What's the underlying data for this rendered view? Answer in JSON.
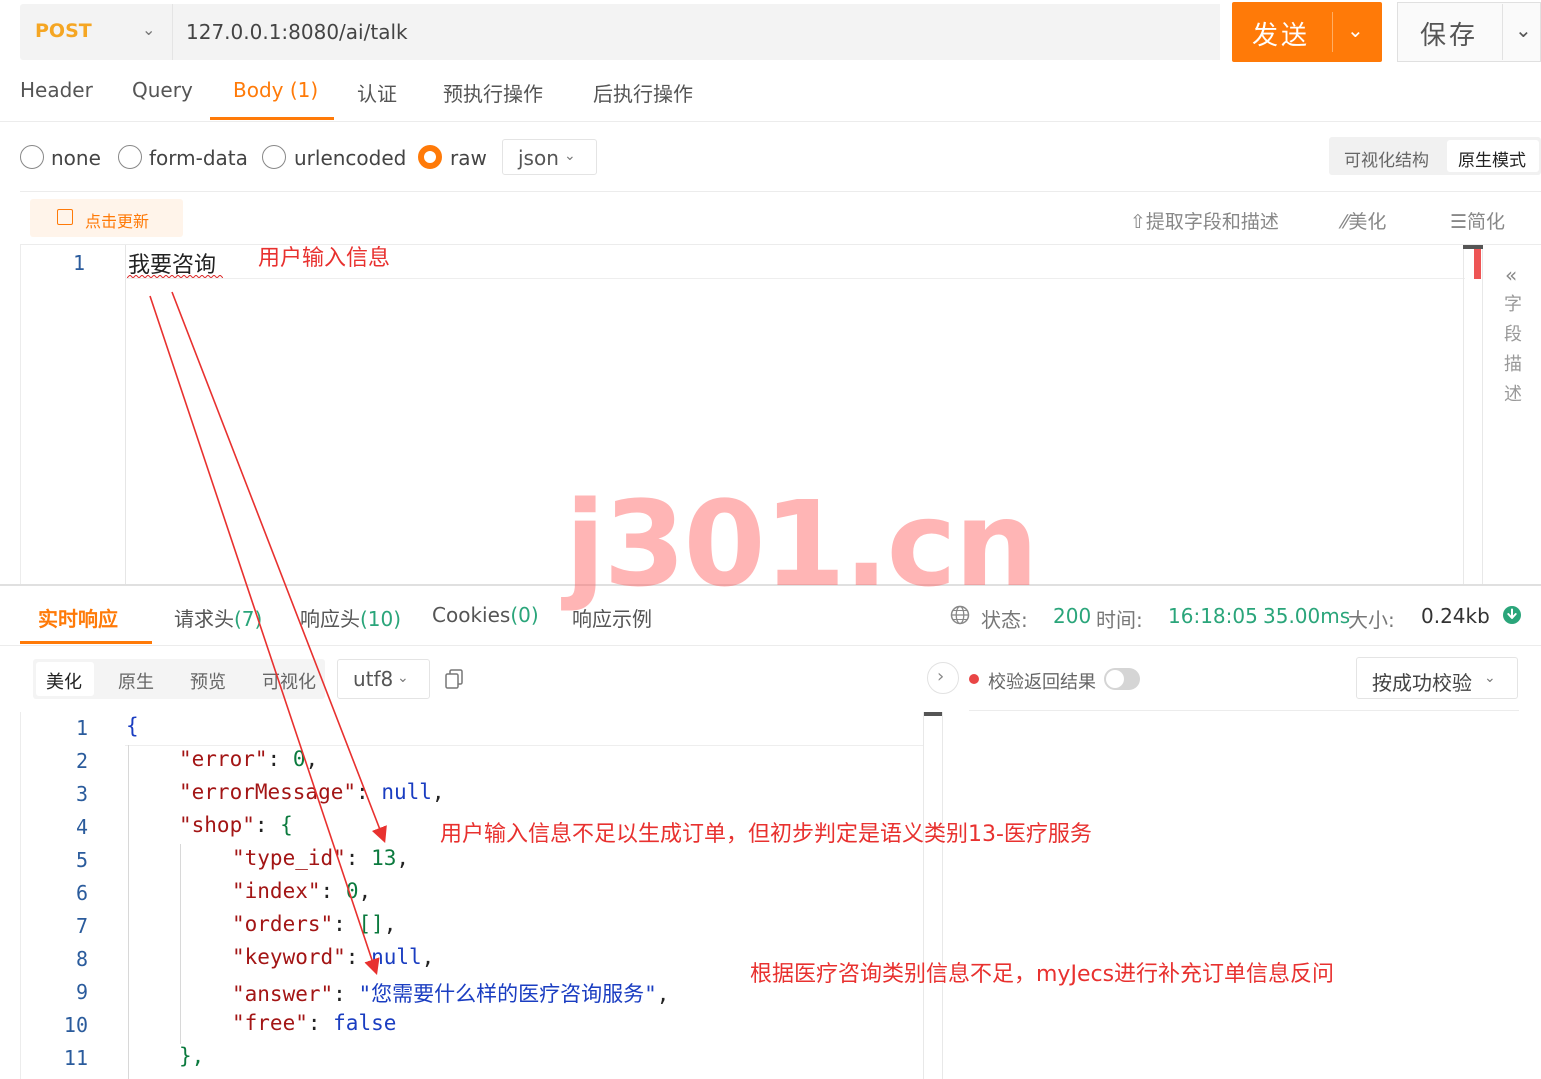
{
  "request": {
    "method": "POST",
    "url": "127.0.0.1:8080/ai/talk",
    "send_label": "发送",
    "save_label": "保存"
  },
  "request_tabs": {
    "header": "Header",
    "query": "Query",
    "body": "Body",
    "body_count": "(1)",
    "auth": "认证",
    "pre": "预执行操作",
    "post": "后执行操作"
  },
  "body_types": {
    "none": "none",
    "form_data": "form-data",
    "urlencoded": "urlencoded",
    "raw": "raw",
    "selected": "raw",
    "format": "json"
  },
  "editor_mode": {
    "visual": "可视化结构",
    "raw": "原生模式"
  },
  "editor_toolbar": {
    "update": "点击更新",
    "extract": "⇧提取字段和描述",
    "beautify": "⁄⁄美化",
    "simplify": "☰简化"
  },
  "request_editor": {
    "line_number": "1",
    "line_text": "我要咨询"
  },
  "field_panel": {
    "icon": "«",
    "label": "字段描述"
  },
  "response_tabs": {
    "live": "实时响应",
    "req_headers": "请求头",
    "req_headers_count": "(7)",
    "resp_headers": "响应头",
    "resp_headers_count": "(10)",
    "cookies": "Cookies",
    "cookies_count": "(0)",
    "example": "响应示例"
  },
  "status": {
    "status_label": "状态:",
    "status_value": "200",
    "time_label": "时间:",
    "time_value": "16:18:05",
    "duration": "35.00ms",
    "size_label": "大小:",
    "size_value": "0.24kb"
  },
  "response_view": {
    "beautify": "美化",
    "raw": "原生",
    "preview": "预览",
    "visual": "可视化",
    "encoding": "utf8"
  },
  "validation": {
    "label": "校验返回结果",
    "enabled": false,
    "mode": "按成功校验"
  },
  "response_code": {
    "line_numbers": [
      "1",
      "2",
      "3",
      "4",
      "5",
      "6",
      "7",
      "8",
      "9",
      "10",
      "11"
    ],
    "l1_brace": "{",
    "l2_key": "\"error\"",
    "l2_val": "0",
    "l3_key": "\"errorMessage\"",
    "l3_val": "null",
    "l4_key": "\"shop\"",
    "l4_brace": "{",
    "l5_key": "\"type_id\"",
    "l5_val": "13",
    "l6_key": "\"index\"",
    "l6_val": "0",
    "l7_key": "\"orders\"",
    "l7_val": "[]",
    "l8_key": "\"keyword\"",
    "l8_val": "null",
    "l9_key": "\"answer\"",
    "l9_val": "\"您需要什么样的医疗咨询服务\"",
    "l10_key": "\"free\"",
    "l10_val": "false",
    "l11_close": "},"
  },
  "annotations": {
    "user_input": "用户输入信息",
    "judgement": "用户输入信息不足以生成订单，但初步判定是语义类别13-医疗服务",
    "follow_up": "根据医疗咨询类别信息不足，myJecs进行补充订单信息反问",
    "watermark": "j301.cn",
    "color": "#e8312f"
  },
  "colors": {
    "accent": "#ff7a08",
    "success": "#2aa57a",
    "method": "#f5a623",
    "line_number": "#2a5b9c"
  }
}
